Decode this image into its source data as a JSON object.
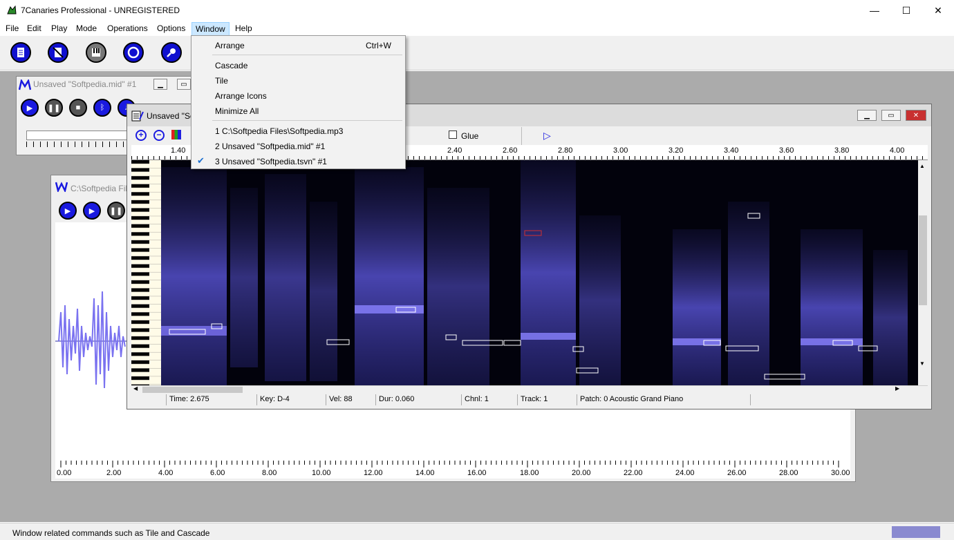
{
  "app": {
    "title": "7Canaries Professional - UNREGISTERED",
    "icon": "canary-app-icon"
  },
  "window_controls": {
    "minimize": "—",
    "maximize": "☐",
    "close": "✕"
  },
  "menubar": [
    "File",
    "Edit",
    "Play",
    "Mode",
    "Operations",
    "Options",
    "Window",
    "Help"
  ],
  "toolbar": {
    "buttons": [
      "new-document-icon",
      "no-document-icon",
      "piano-keys-icon",
      "record-circle-icon",
      "microphone-icon"
    ]
  },
  "window_menu": {
    "items": [
      {
        "label": "Arrange",
        "shortcut": "Ctrl+W"
      },
      {
        "label": "Cascade"
      },
      {
        "label": "Tile"
      },
      {
        "label": "Arrange Icons"
      },
      {
        "label": "Minimize All"
      },
      {
        "label": "1 C:\\Softpedia Files\\Softpedia.mp3"
      },
      {
        "label": "2 Unsaved \"Softpedia.mid\" #1"
      },
      {
        "label": "3 Unsaved \"Softpedia.tsvn\" #1",
        "checked": true
      }
    ]
  },
  "midi_window": {
    "title": "Unsaved \"Softpedia.mid\" #1"
  },
  "audio_window": {
    "title": "C:\\Softpedia Fil",
    "ruler": [
      "0.00",
      "2.00",
      "4.00",
      "6.00",
      "8.00",
      "10.00",
      "12.00",
      "14.00",
      "16.00",
      "18.00",
      "20.00",
      "22.00",
      "24.00",
      "26.00",
      "28.00",
      "30.00"
    ]
  },
  "tsvn_window": {
    "title": "Unsaved \"So",
    "glue_label": "Glue",
    "ruler": [
      "1.40",
      "2.40",
      "2.60",
      "2.80",
      "3.00",
      "3.20",
      "3.40",
      "3.60",
      "3.80",
      "4.00"
    ],
    "status": {
      "time": "Time: 2.675",
      "key": "Key: D-4",
      "vel": "Vel: 88",
      "dur": "Dur: 0.060",
      "chnl": "Chnl: 1",
      "track": "Track: 1",
      "patch": "Patch: 0 Acoustic Grand Piano"
    }
  },
  "status_bar": {
    "text": "Window related commands such as Tile and Cascade"
  },
  "colors": {
    "accent": "#1a1ae0",
    "menu_highlight": "#cce8ff",
    "spectro_bg": "#02020c",
    "spectro_purple": "#7a72f0"
  }
}
